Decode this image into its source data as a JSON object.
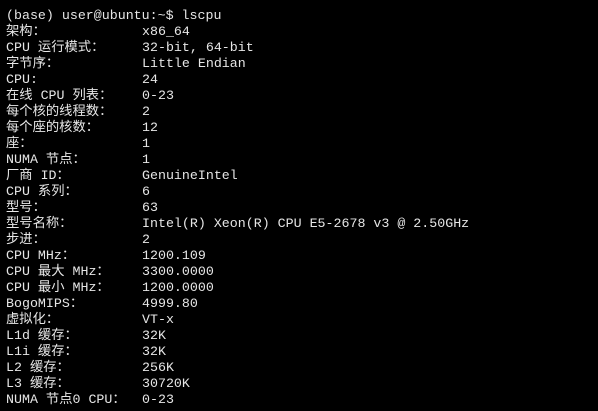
{
  "prompt": "(base) user@ubuntu:~$ lscpu",
  "rows": [
    {
      "label": "架构：",
      "value": "x86_64"
    },
    {
      "label": "CPU 运行模式：",
      "value": "32-bit, 64-bit"
    },
    {
      "label": "字节序：",
      "value": "Little Endian"
    },
    {
      "label": "CPU:",
      "value": "24"
    },
    {
      "label": "在线 CPU 列表：",
      "value": "0-23"
    },
    {
      "label": "每个核的线程数：",
      "value": "2"
    },
    {
      "label": "每个座的核数：",
      "value": "12"
    },
    {
      "label": "座：",
      "value": "1"
    },
    {
      "label": "NUMA 节点：",
      "value": "1"
    },
    {
      "label": "厂商 ID：",
      "value": "GenuineIntel"
    },
    {
      "label": "CPU 系列：",
      "value": "6"
    },
    {
      "label": "型号：",
      "value": "63"
    },
    {
      "label": "型号名称：",
      "value": "Intel(R) Xeon(R) CPU E5-2678 v3 @ 2.50GHz"
    },
    {
      "label": "步进：",
      "value": "2"
    },
    {
      "label": "CPU MHz：",
      "value": "1200.109"
    },
    {
      "label": "CPU 最大 MHz：",
      "value": "3300.0000"
    },
    {
      "label": "CPU 最小 MHz：",
      "value": "1200.0000"
    },
    {
      "label": "BogoMIPS：",
      "value": "4999.80"
    },
    {
      "label": "虚拟化：",
      "value": "VT-x"
    },
    {
      "label": "L1d 缓存：",
      "value": "32K"
    },
    {
      "label": "L1i 缓存：",
      "value": "32K"
    },
    {
      "label": "L2 缓存：",
      "value": "256K"
    },
    {
      "label": "L3 缓存：",
      "value": "30720K"
    },
    {
      "label": "NUMA 节点0 CPU：",
      "value": "0-23"
    }
  ]
}
